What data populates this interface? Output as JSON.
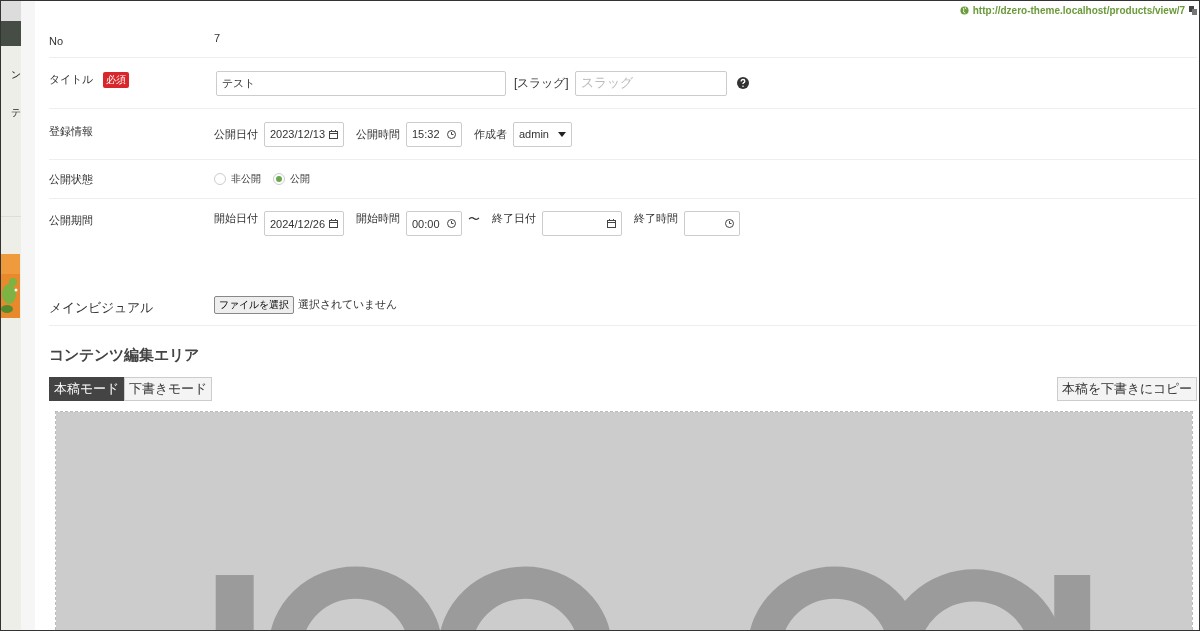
{
  "url_bar": {
    "url": "http://dzero-theme.localhost/products/view/7"
  },
  "sidebar": {
    "items": [
      {
        "label": "ン"
      },
      {
        "label": "テ"
      }
    ]
  },
  "form": {
    "no": {
      "label": "No",
      "value": "7"
    },
    "title": {
      "label": "タイトル",
      "required_badge": "必須",
      "value": "テスト",
      "slug_label": "[スラッグ]",
      "slug_placeholder": "スラッグ"
    },
    "registration": {
      "label": "登録情報",
      "fields": [
        {
          "kind": "date",
          "label": "公開日付",
          "value": "2023/12/13"
        },
        {
          "kind": "time",
          "label": "公開時間",
          "value": "15:32"
        },
        {
          "kind": "select",
          "label": "作成者",
          "value": "admin"
        }
      ]
    },
    "status": {
      "label": "公開状態",
      "options": [
        {
          "label": "非公開",
          "selected": false
        },
        {
          "label": "公開",
          "selected": true
        }
      ]
    },
    "period": {
      "label": "公開期間",
      "fields": [
        {
          "kind": "date",
          "label": "開始日付",
          "value": "2024/12/26"
        },
        {
          "kind": "time",
          "label": "開始時間",
          "value": "00:00"
        },
        {
          "kind": "separator",
          "text": "〜"
        },
        {
          "kind": "date",
          "label": "終了日付"
        },
        {
          "kind": "time",
          "label": "終了時間"
        }
      ]
    },
    "main_visual": {
      "label": "メインビジュアル",
      "button": "ファイルを選択",
      "status": "選択されていません"
    }
  },
  "content": {
    "heading": "コンテンツ編集エリア",
    "modes": [
      {
        "label": "本稿モード",
        "selected": true
      },
      {
        "label": "下書きモード",
        "selected": false
      }
    ],
    "copy_button": "本稿を下書きにコピー"
  }
}
